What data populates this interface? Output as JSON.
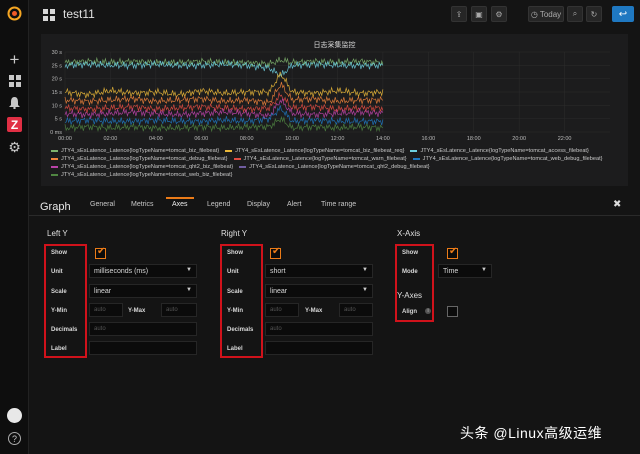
{
  "dashboard": {
    "title": "test11"
  },
  "toolbar": {
    "today_label": "Today"
  },
  "panel": {
    "title": "日志采集监控",
    "legend": [
      {
        "name": "JTY4_sEsLatence_Latence{logTypeName=tomcat_biz_filebeat}",
        "color": "#7eb26d"
      },
      {
        "name": "JTY4_sEsLatence_Latence{logTypeName=tomcat_biz_filebeat_req}",
        "color": "#eab839"
      },
      {
        "name": "JTY4_sEsLatence_Latence{logTypeName=tomcat_access_filebeat}",
        "color": "#6ed0e0"
      },
      {
        "name": "JTY4_sEsLatence_Latence{logTypeName=tomcat_debug_filebeat}",
        "color": "#ef843c"
      },
      {
        "name": "JTY4_sEsLatence_Latence{logTypeName=tomcat_warn_filebeat}",
        "color": "#e24d42"
      },
      {
        "name": "JTY4_sEsLatence_Latence{logTypeName=tomcat_web_debug_filebeat}",
        "color": "#1f78c1"
      },
      {
        "name": "JTY4_sEsLatence_Latence{logTypeName=tomcat_qht2_biz_filebeat}",
        "color": "#ba43a9"
      },
      {
        "name": "JTY4_sEsLatence_Latence{logTypeName=tomcat_qht2_debug_filebeat}",
        "color": "#705da0"
      },
      {
        "name": "JTY4_sEsLatence_Latence{logTypeName=tomcat_web_biz_filebeat}",
        "color": "#508642"
      }
    ]
  },
  "chart_data": {
    "type": "line",
    "title": "日志采集监控",
    "y_ticks": [
      "0 ms",
      "5 s",
      "10 s",
      "15 s",
      "20 s",
      "25 s",
      "30 s"
    ],
    "ylim": [
      0,
      30
    ],
    "x_ticks": [
      "00:00",
      "02:00",
      "04:00",
      "06:00",
      "08:00",
      "10:00",
      "12:00",
      "14:00",
      "16:00",
      "18:00",
      "20:00",
      "22:00"
    ],
    "xlim_hours": [
      0,
      24
    ],
    "data_end_hour": 14,
    "grid": true,
    "series": [
      {
        "color": "#7eb26d",
        "x_hours": [
          0,
          1,
          2,
          3,
          4,
          5,
          6,
          7,
          8,
          9,
          9.5,
          10,
          11,
          12,
          13,
          14
        ],
        "y": [
          26,
          26.5,
          26,
          26.5,
          26,
          26,
          26.5,
          26,
          26,
          25.5,
          27,
          26,
          26.5,
          26,
          26.5,
          26
        ]
      },
      {
        "color": "#6ed0e0",
        "x_hours": [
          0,
          1,
          2,
          3,
          4,
          5,
          6,
          7,
          8,
          9,
          9.5,
          10,
          11,
          12,
          13,
          14
        ],
        "y": [
          25,
          25.5,
          25,
          25,
          25.5,
          25,
          25,
          25.5,
          25,
          24,
          21,
          25,
          25.5,
          25,
          25,
          25
        ]
      },
      {
        "color": "#eab839",
        "x_hours": [
          0,
          1,
          2,
          3,
          4,
          5,
          6,
          7,
          8,
          9,
          9.5,
          10,
          11,
          12,
          13,
          14
        ],
        "y": [
          15,
          14,
          15.5,
          14.5,
          15,
          14,
          15.5,
          14.5,
          15,
          15,
          22,
          15,
          14.5,
          15.5,
          14.5,
          15
        ]
      },
      {
        "color": "#ef843c",
        "x_hours": [
          0,
          1,
          2,
          3,
          4,
          5,
          6,
          7,
          8,
          9,
          9.5,
          10,
          11,
          12,
          13,
          14
        ],
        "y": [
          12,
          11.5,
          12,
          12.5,
          11.5,
          12,
          12.5,
          11.5,
          12,
          11,
          18,
          12,
          12.5,
          11.5,
          12,
          12
        ]
      },
      {
        "color": "#e24d42",
        "x_hours": [
          0,
          1,
          2,
          3,
          4,
          5,
          6,
          7,
          8,
          9,
          9.5,
          10,
          11,
          12,
          13,
          14
        ],
        "y": [
          9,
          8.5,
          9,
          9.5,
          8.5,
          9,
          9.5,
          9,
          8.5,
          9,
          14,
          9,
          9.5,
          8.5,
          9,
          9
        ]
      },
      {
        "color": "#ba43a9",
        "x_hours": [
          0,
          1,
          2,
          3,
          4,
          5,
          6,
          7,
          8,
          9,
          9.5,
          10,
          11,
          12,
          13,
          14
        ],
        "y": [
          7,
          6.5,
          7,
          7.5,
          7,
          6.5,
          7,
          7.5,
          7,
          6,
          12,
          7,
          6.5,
          7,
          7.5,
          7
        ]
      },
      {
        "color": "#1f78c1",
        "x_hours": [
          0,
          1,
          2,
          3,
          4,
          5,
          6,
          7,
          8,
          9,
          9.5,
          10,
          11,
          12,
          13,
          14
        ],
        "y": [
          4,
          4.5,
          4,
          4,
          4.5,
          4,
          4,
          4.5,
          4,
          5,
          9,
          4,
          4.5,
          4,
          4,
          4
        ]
      },
      {
        "color": "#508642",
        "x_hours": [
          0,
          1,
          2,
          3,
          4,
          5,
          6,
          7,
          8,
          9,
          9.5,
          10,
          11,
          12,
          13,
          14
        ],
        "y": [
          1.5,
          2,
          1.5,
          2,
          1.5,
          1.5,
          2,
          1.5,
          2,
          2,
          5,
          1.5,
          2,
          1.5,
          2,
          1.5
        ]
      }
    ]
  },
  "editor": {
    "graph_label": "Graph",
    "tabs": [
      "General",
      "Metrics",
      "Axes",
      "Legend",
      "Display",
      "Alert",
      "Time range"
    ],
    "active_tab": "Axes",
    "left_y": {
      "title": "Left Y",
      "show_label": "Show",
      "unit_label": "Unit",
      "unit_value": "milliseconds (ms)",
      "scale_label": "Scale",
      "scale_value": "linear",
      "ymin_label": "Y-Min",
      "ymin_placeholder": "auto",
      "ymax_label": "Y-Max",
      "ymax_placeholder": "auto",
      "decimals_label": "Decimals",
      "decimals_placeholder": "auto",
      "label_label": "Label"
    },
    "right_y": {
      "title": "Right Y",
      "show_label": "Show",
      "unit_label": "Unit",
      "unit_value": "short",
      "scale_label": "Scale",
      "scale_value": "linear",
      "ymin_label": "Y-Min",
      "ymin_placeholder": "auto",
      "ymax_label": "Y-Max",
      "ymax_placeholder": "auto",
      "decimals_label": "Decimals",
      "decimals_placeholder": "auto",
      "label_label": "Label"
    },
    "x_axis": {
      "title": "X-Axis",
      "show_label": "Show",
      "mode_label": "Mode",
      "mode_value": "Time"
    },
    "y_axes": {
      "title": "Y-Axes",
      "align_label": "Align"
    }
  },
  "watermark": "头条 @Linux高级运维"
}
